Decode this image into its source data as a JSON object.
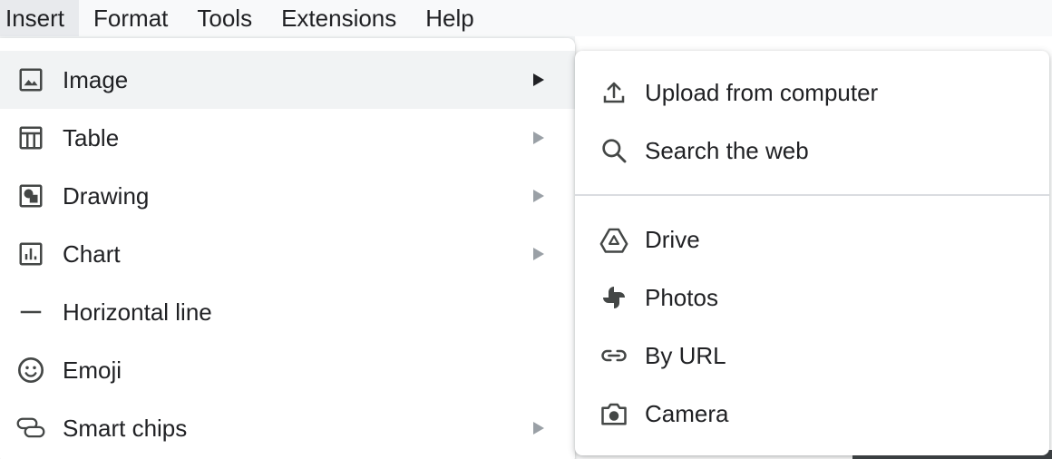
{
  "menubar": {
    "items": [
      {
        "label": "Insert"
      },
      {
        "label": "Format"
      },
      {
        "label": "Tools"
      },
      {
        "label": "Extensions"
      },
      {
        "label": "Help"
      }
    ]
  },
  "insert_menu": {
    "items": [
      {
        "label": "Image",
        "icon": "image-icon",
        "has_submenu": true
      },
      {
        "label": "Table",
        "icon": "table-icon",
        "has_submenu": true
      },
      {
        "label": "Drawing",
        "icon": "drawing-icon",
        "has_submenu": true
      },
      {
        "label": "Chart",
        "icon": "chart-icon",
        "has_submenu": true
      },
      {
        "label": "Horizontal line",
        "icon": "horizontal-line-icon",
        "has_submenu": false
      },
      {
        "label": "Emoji",
        "icon": "emoji-icon",
        "has_submenu": false
      },
      {
        "label": "Smart chips",
        "icon": "smart-chips-icon",
        "has_submenu": true
      }
    ]
  },
  "image_submenu": {
    "items": [
      {
        "label": "Upload from computer",
        "icon": "upload-icon"
      },
      {
        "label": "Search the web",
        "icon": "search-icon"
      },
      {
        "label": "Drive",
        "icon": "drive-icon"
      },
      {
        "label": "Photos",
        "icon": "photos-icon"
      },
      {
        "label": "By URL",
        "icon": "link-icon"
      },
      {
        "label": "Camera",
        "icon": "camera-icon"
      }
    ]
  },
  "colors": {
    "text": "#202124",
    "icon": "#444746",
    "highlight": "#f1f3f4",
    "arrow_active": "#202124",
    "arrow_inactive": "#9aa0a6",
    "divider": "#dadce0"
  }
}
